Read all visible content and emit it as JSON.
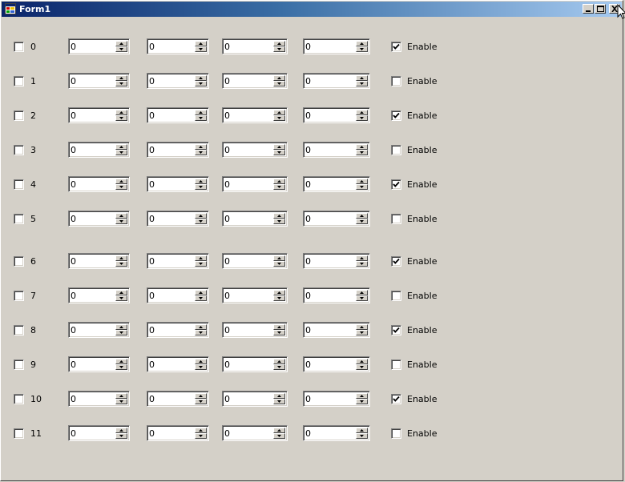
{
  "window": {
    "title": "Form1",
    "controls": {
      "minimize": "minimize",
      "maximize": "maximize",
      "close": "close"
    }
  },
  "enable_label": "Enable",
  "rows": [
    {
      "label": "0",
      "checked": false,
      "values": [
        "0",
        "0",
        "0",
        "0"
      ],
      "enabled": true
    },
    {
      "label": "1",
      "checked": false,
      "values": [
        "0",
        "0",
        "0",
        "0"
      ],
      "enabled": false
    },
    {
      "label": "2",
      "checked": false,
      "values": [
        "0",
        "0",
        "0",
        "0"
      ],
      "enabled": true
    },
    {
      "label": "3",
      "checked": false,
      "values": [
        "0",
        "0",
        "0",
        "0"
      ],
      "enabled": false
    },
    {
      "label": "4",
      "checked": false,
      "values": [
        "0",
        "0",
        "0",
        "0"
      ],
      "enabled": true
    },
    {
      "label": "5",
      "checked": false,
      "values": [
        "0",
        "0",
        "0",
        "0"
      ],
      "enabled": false
    },
    {
      "label": "6",
      "checked": false,
      "values": [
        "0",
        "0",
        "0",
        "0"
      ],
      "enabled": true
    },
    {
      "label": "7",
      "checked": false,
      "values": [
        "0",
        "0",
        "0",
        "0"
      ],
      "enabled": false
    },
    {
      "label": "8",
      "checked": false,
      "values": [
        "0",
        "0",
        "0",
        "0"
      ],
      "enabled": true
    },
    {
      "label": "9",
      "checked": false,
      "values": [
        "0",
        "0",
        "0",
        "0"
      ],
      "enabled": false
    },
    {
      "label": "10",
      "checked": false,
      "values": [
        "0",
        "0",
        "0",
        "0"
      ],
      "enabled": true
    },
    {
      "label": "11",
      "checked": false,
      "values": [
        "0",
        "0",
        "0",
        "0"
      ],
      "enabled": false
    }
  ],
  "colors": {
    "face": "#d4d0c8",
    "title_start": "#0a246a",
    "title_end": "#a6caf0"
  }
}
